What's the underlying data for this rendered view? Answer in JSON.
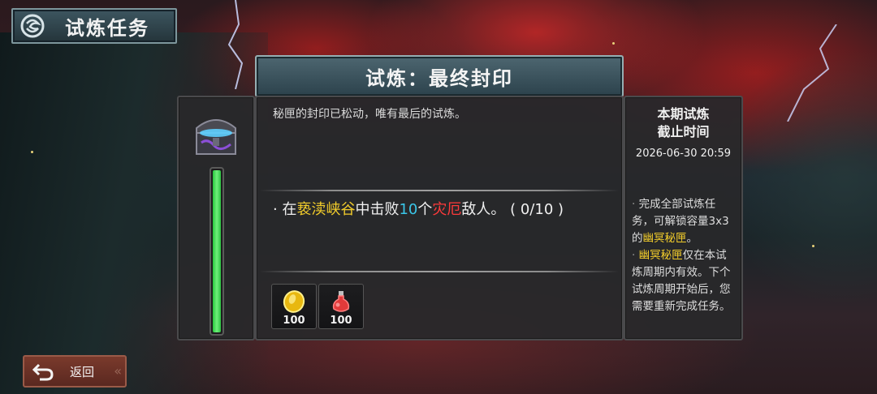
{
  "header": {
    "title": "试炼任务",
    "logo_icon": "swirl-emblem-icon"
  },
  "banner": {
    "title": "试炼：最终封印"
  },
  "progress": {
    "chest_icon": "treasure-chest-icon",
    "fill_fraction": 0.98
  },
  "quest": {
    "description": "秘匣的封印已松动，唯有最后的试炼。",
    "task": {
      "bullet": "·",
      "prefix": "在",
      "location": "亵渎峡谷",
      "mid": "中击败",
      "count": "10",
      "unit": "个",
      "enemy": "灾厄",
      "suffix": "敌人。",
      "progress_text": "( 0/10 )"
    },
    "rewards": [
      {
        "icon": "gold-coin-icon",
        "amount": "100"
      },
      {
        "icon": "red-potion-icon",
        "amount": "100"
      }
    ]
  },
  "deadline": {
    "heading_line1": "本期试炼",
    "heading_line2": "截止时间",
    "datetime": "2026-06-30 20:59"
  },
  "info": {
    "line1_a": "完成全部试炼任务，可解锁容量3x3的",
    "line1_hl": "幽冥秘匣",
    "line1_b": "。",
    "line2_hl": "幽冥秘匣",
    "line2_b": "仅在本试炼周期内有效。下个试炼周期开始后，您需要重新完成任务。"
  },
  "footer": {
    "back_label": "返回",
    "back_icon": "return-arrow-icon"
  },
  "colors": {
    "highlight_yellow": "#f3cd2b",
    "highlight_cyan": "#3ac6e8",
    "highlight_red": "#ff3a3a",
    "progress_green": "#3ddc4c",
    "back_button": "#6a3024"
  }
}
